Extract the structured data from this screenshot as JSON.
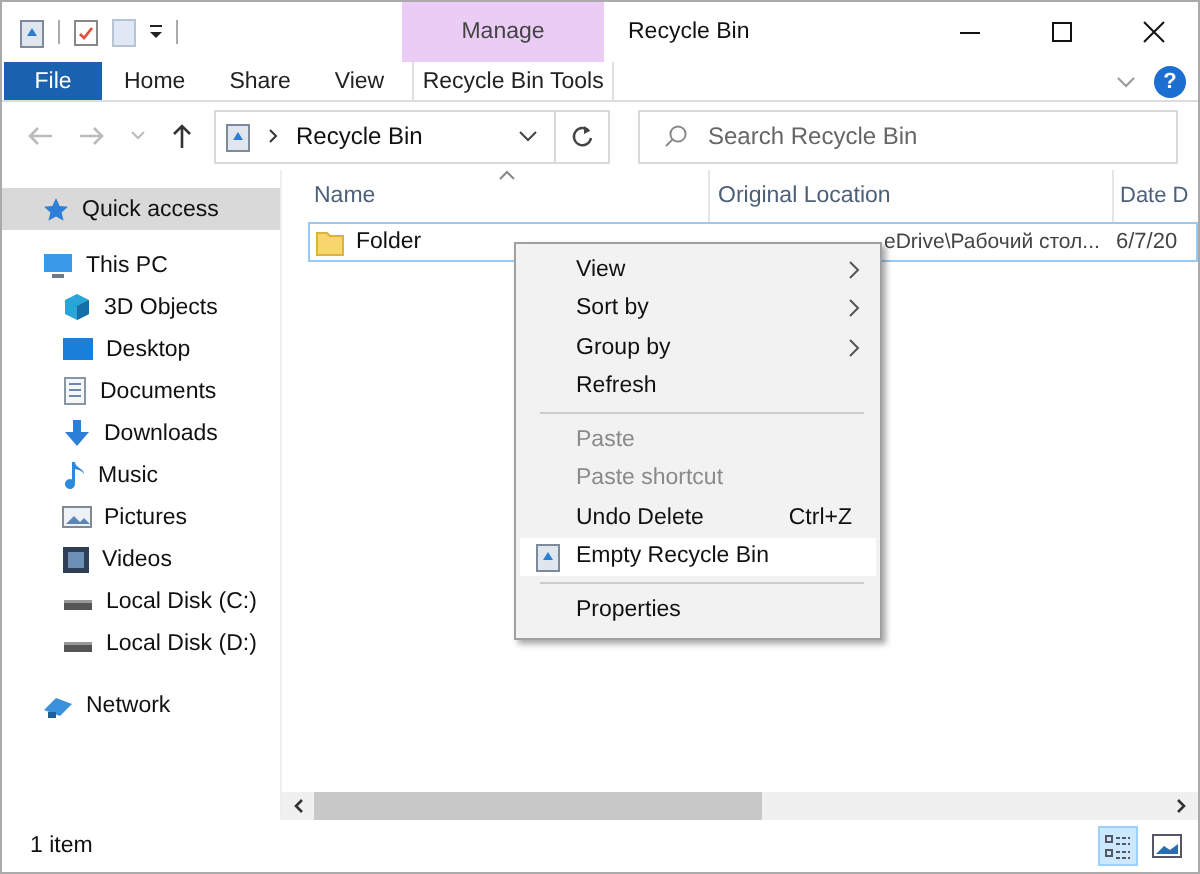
{
  "window": {
    "title": "Recycle Bin"
  },
  "ribbon": {
    "context_label": "Manage",
    "tabs": [
      {
        "label": "File",
        "kind": "file",
        "selected": false
      },
      {
        "label": "Home",
        "kind": "normal",
        "selected": false
      },
      {
        "label": "Share",
        "kind": "normal",
        "selected": false
      },
      {
        "label": "View",
        "kind": "normal",
        "selected": false
      },
      {
        "label": "Recycle Bin Tools",
        "kind": "contextual",
        "selected": false
      }
    ],
    "help": "?"
  },
  "address_bar": {
    "path": "Recycle Bin"
  },
  "search": {
    "placeholder": "Search Recycle Bin"
  },
  "sidebar": {
    "items": [
      {
        "label": "Quick access",
        "kind": "star",
        "selected": true
      },
      {
        "label": "This PC",
        "kind": "pc",
        "selected": false,
        "children": [
          {
            "label": "3D Objects",
            "kind": "cube",
            "selected": false
          },
          {
            "label": "Desktop",
            "kind": "desktop",
            "selected": false
          },
          {
            "label": "Documents",
            "kind": "doc",
            "selected": false
          },
          {
            "label": "Downloads",
            "kind": "down",
            "selected": false
          },
          {
            "label": "Music",
            "kind": "music",
            "selected": false
          },
          {
            "label": "Pictures",
            "kind": "pictures",
            "selected": false
          },
          {
            "label": "Videos",
            "kind": "videos",
            "selected": false
          },
          {
            "label": "Local Disk (C:)",
            "kind": "disk",
            "selected": false
          },
          {
            "label": "Local Disk (D:)",
            "kind": "disk",
            "selected": false
          }
        ]
      },
      {
        "label": "Network",
        "kind": "network",
        "selected": false
      }
    ]
  },
  "table": {
    "columns": [
      "Name",
      "Original Location",
      "Date D"
    ],
    "rows": [
      {
        "name": "Folder",
        "original_location": "eDrive\\Рабочий стол...",
        "date": "6/7/20",
        "focused": true
      }
    ]
  },
  "context_menu": {
    "items": [
      {
        "kind": "item",
        "label": "View",
        "submenu": true,
        "disabled": false,
        "selected": false
      },
      {
        "kind": "item",
        "label": "Sort by",
        "submenu": true,
        "disabled": false,
        "selected": false
      },
      {
        "kind": "item",
        "label": "Group by",
        "submenu": true,
        "disabled": false,
        "selected": false
      },
      {
        "kind": "item",
        "label": "Refresh",
        "submenu": false,
        "disabled": false,
        "selected": false
      },
      {
        "kind": "separator"
      },
      {
        "kind": "item",
        "label": "Paste",
        "submenu": false,
        "disabled": true,
        "selected": false
      },
      {
        "kind": "item",
        "label": "Paste shortcut",
        "submenu": false,
        "disabled": true,
        "selected": false
      },
      {
        "kind": "item",
        "label": "Undo Delete",
        "shortcut": "Ctrl+Z",
        "submenu": false,
        "disabled": false,
        "selected": false
      },
      {
        "kind": "bin",
        "label": "Empty Recycle Bin",
        "submenu": false,
        "disabled": false,
        "selected": true
      },
      {
        "kind": "separator"
      },
      {
        "kind": "item",
        "label": "Properties",
        "submenu": false,
        "disabled": false,
        "selected": false
      }
    ]
  },
  "status_bar": {
    "text": "1 item",
    "views": [
      {
        "kind": "details",
        "selected": true
      },
      {
        "kind": "large",
        "selected": false
      }
    ]
  }
}
